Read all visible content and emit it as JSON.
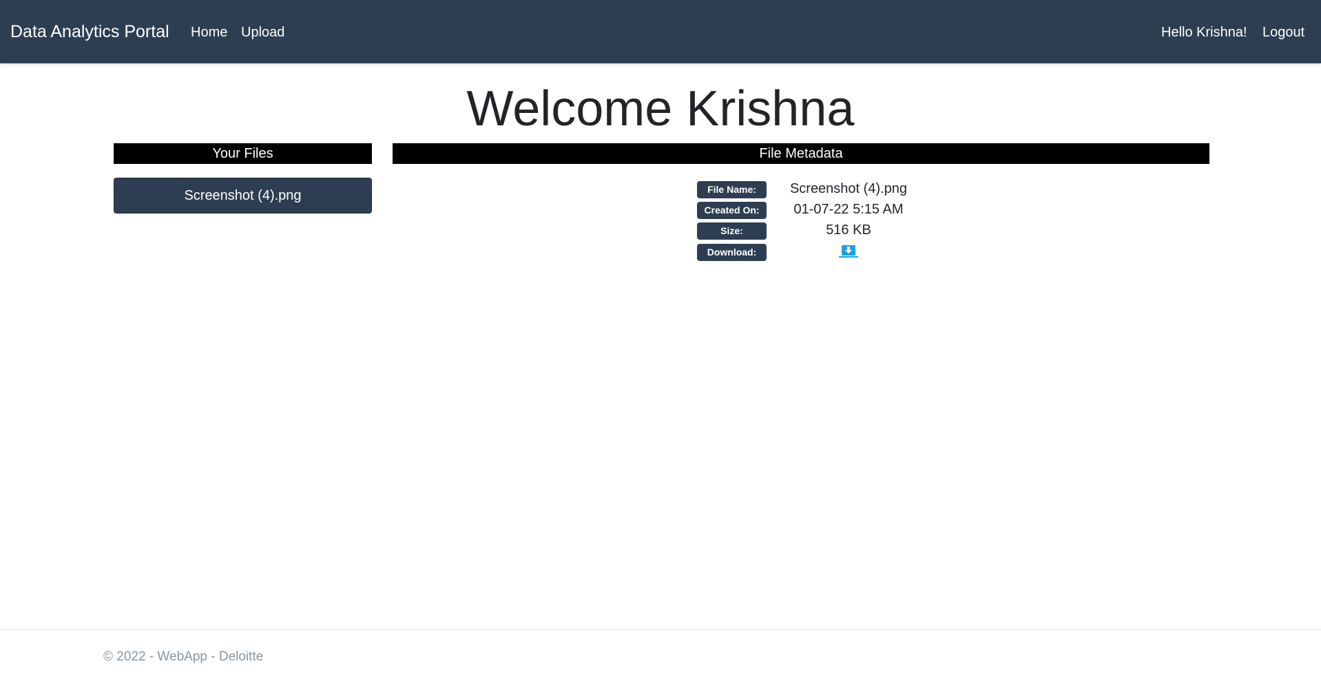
{
  "navbar": {
    "brand": "Data Analytics Portal",
    "links": {
      "home": "Home",
      "upload": "Upload"
    },
    "greeting": "Hello Krishna!",
    "logout": "Logout",
    "background_color": "#2e3e52"
  },
  "main": {
    "welcome_title": "Welcome Krishna",
    "files_panel": {
      "header": "Your Files",
      "files": [
        "Screenshot (4).png"
      ]
    },
    "metadata_panel": {
      "header": "File Metadata",
      "labels": {
        "file_name": "File Name:",
        "created_on": "Created On:",
        "size": "Size:",
        "download": "Download:"
      },
      "values": {
        "file_name": "Screenshot (4).png",
        "created_on": "01-07-22 5:15 AM",
        "size": "516 KB"
      },
      "download_icon": "download-arrow-icon",
      "download_icon_color": "#1ba1e2"
    }
  },
  "footer": {
    "text": "© 2022 - WebApp - Deloitte"
  }
}
